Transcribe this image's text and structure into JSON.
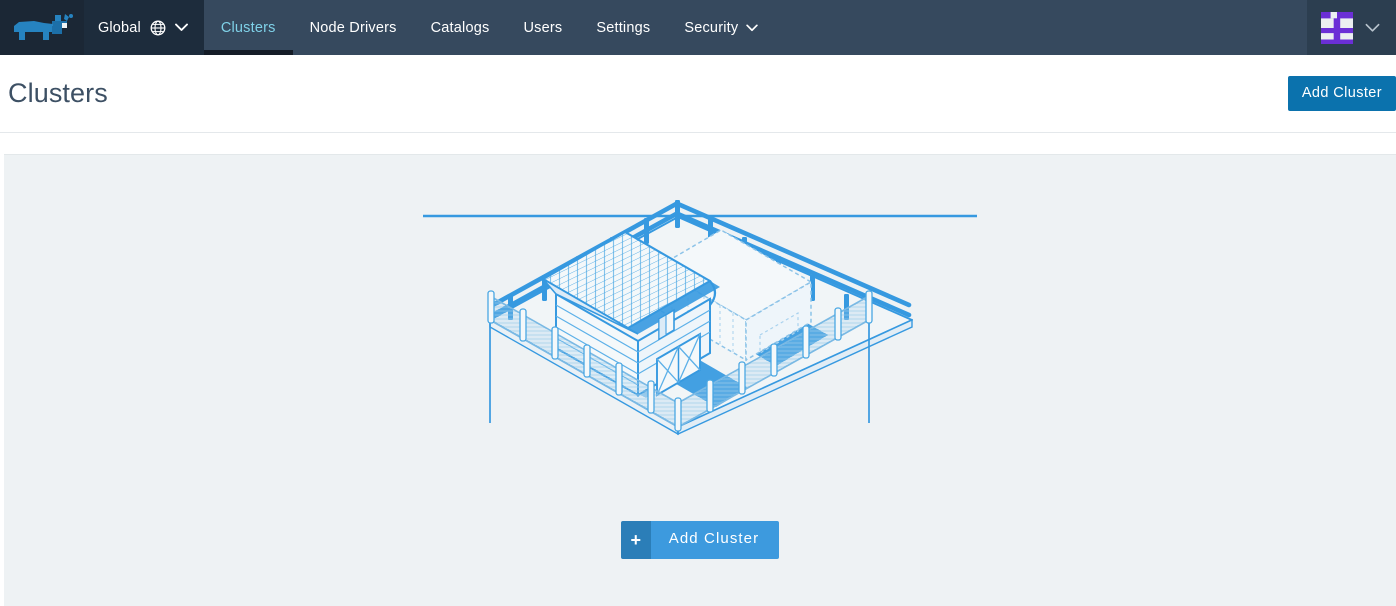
{
  "navbar": {
    "logo_icon": "rancher-cow-logo",
    "cluster_picker": {
      "label": "Global",
      "globe_icon": "globe-icon",
      "caret_icon": "chevron-down-icon"
    },
    "links": [
      {
        "label": "Clusters",
        "active": true
      },
      {
        "label": "Node Drivers",
        "active": false
      },
      {
        "label": "Catalogs",
        "active": false
      },
      {
        "label": "Users",
        "active": false
      },
      {
        "label": "Settings",
        "active": false
      },
      {
        "label": "Security",
        "active": false,
        "caret_icon": "chevron-down-icon"
      }
    ],
    "user_menu": {
      "avatar_icon": "user-avatar-identicon",
      "caret_icon": "chevron-down-icon"
    }
  },
  "page": {
    "title": "Clusters",
    "header_button": "Add Cluster"
  },
  "empty_state": {
    "illustration_name": "isometric-farm-barn-illustration",
    "add_button": {
      "plus_icon": "plus-icon",
      "label": "Add Cluster"
    }
  },
  "colors": {
    "navbar_bg": "#36495e",
    "navbar_dark": "#1d2c3c",
    "logo_bg": "#1b2735",
    "active_tab_text": "#7fd1e8",
    "active_tab_underline": "#141c27",
    "primary_button": "#0b72ad",
    "cta_button": "#3d9ade",
    "cta_icon_bg": "#2b7eb8",
    "panel_bg": "#eef2f4",
    "title_text": "#3d5064",
    "illustration_blue": "#3699e0",
    "illustration_light": "#8fc5ea",
    "avatar_purple": "#6b2fd6"
  }
}
